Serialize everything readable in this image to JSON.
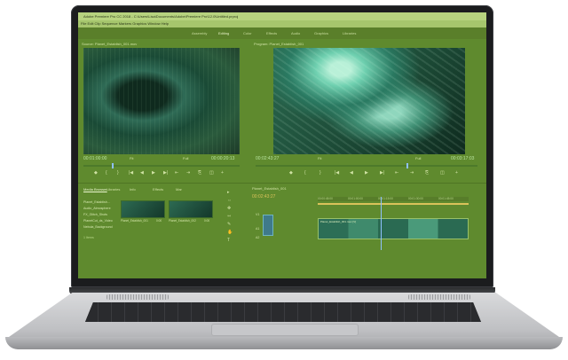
{
  "app": {
    "title": "Adobe Premiere Pro CC 2018 - C:\\Users\\Lisa\\Documents\\Adobe\\Premiere Pro\\12.0\\Untitled.prproj",
    "menu": "File Edit Clip Sequence Markers Graphics Window Help"
  },
  "workspaces": [
    "Assembly",
    "Editing",
    "Color",
    "Effects",
    "Audio",
    "Graphics",
    "Libraries"
  ],
  "source_monitor": {
    "title": "Source: Planet_Establish_001.mov",
    "timecode_in": "00:01:00:00",
    "timecode_out": "00:00:20:13",
    "fit": "Fit",
    "quality": "Full",
    "playhead_fraction": 0.18
  },
  "program_monitor": {
    "title": "Program: Planet_Establish_001",
    "timecode_in": "00:02:43:27",
    "timecode_out": "00:03:17:03",
    "fit": "Fit",
    "quality": "Full",
    "playhead_fraction": 0.68
  },
  "transport": [
    "◆",
    "{",
    "}",
    "|◀",
    "◀",
    "▶",
    "▶|",
    "⇤",
    "⇥",
    "⎘",
    "◫",
    "+"
  ],
  "project_panel": {
    "tabs": [
      "Media Browser",
      "Libraries",
      "Info",
      "Effects",
      "Mar"
    ],
    "items": [
      "Planet_Establish...",
      "Audio_Atmosphere",
      "FX_Glitch_Shots",
      "PlanetCut_ds_Video",
      "Nebula_Background"
    ],
    "folder_label": "1 Items",
    "thumbs": [
      {
        "label": "Planet_Establish_001",
        "duration": "0:00"
      },
      {
        "label": "Planet_Establish_002",
        "duration": "0:00"
      }
    ]
  },
  "timeline": {
    "title": "Planet_Establish_001",
    "timecode": "00:02:43:27",
    "ruler": [
      "00:00:45:00",
      "00:01:00:00",
      "00:01:15:00",
      "00:01:30:00",
      "00:01:45:00"
    ],
    "tracks": [
      "V1",
      "A1",
      "A2"
    ],
    "clip_label": "Planet_Establish_001.mov [V]",
    "playhead_fraction": 0.42
  },
  "tools": [
    "▸",
    "⇔",
    "✥",
    "⇿",
    "✎",
    "✋",
    "T"
  ],
  "colors": {
    "overlay": "#5f8a2e",
    "accent": "#8fc0ff"
  }
}
